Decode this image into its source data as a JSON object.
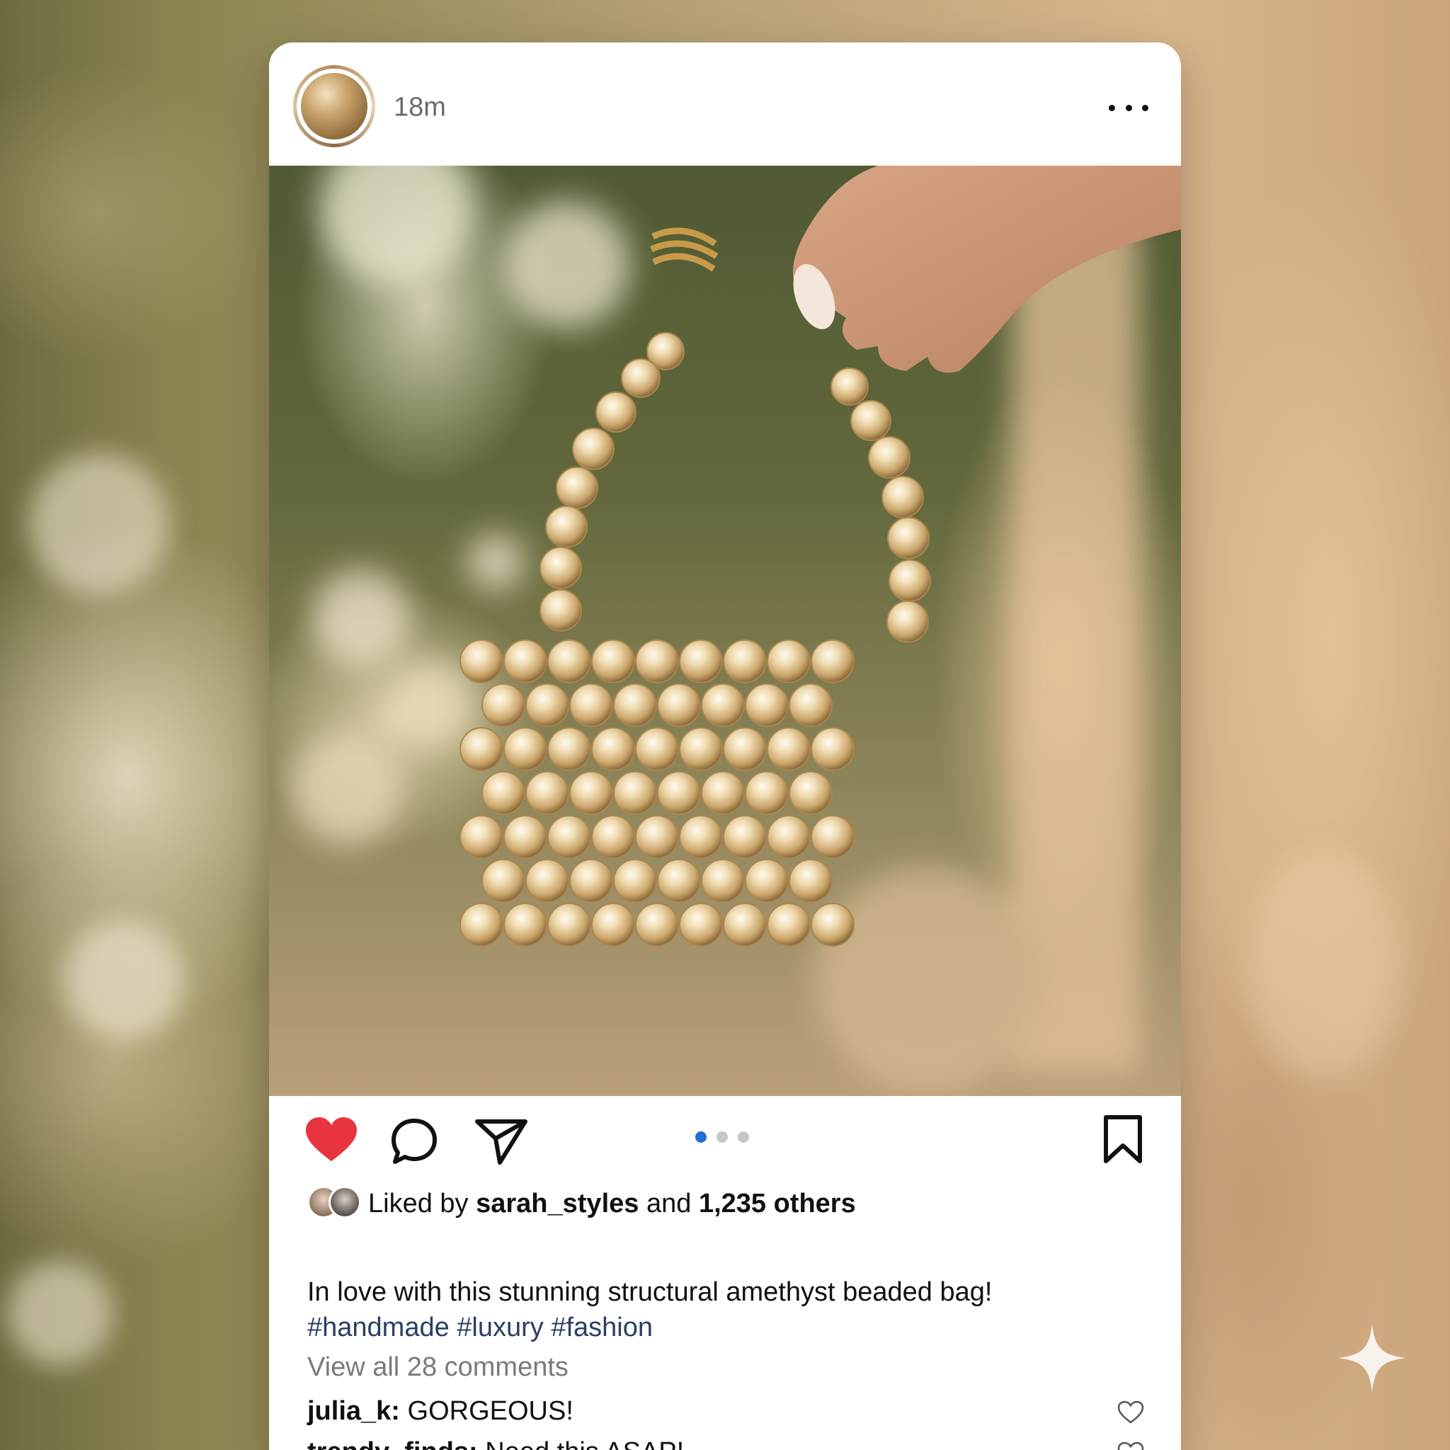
{
  "post": {
    "time_ago": "18m",
    "more_icon": "more-horizontal-icon"
  },
  "carousel": {
    "total": 3,
    "active_index": 0
  },
  "actions": {
    "like_icon": "heart-filled-icon",
    "comment_icon": "comment-icon",
    "share_icon": "send-icon",
    "save_icon": "bookmark-icon",
    "liked": true
  },
  "likes": {
    "prefix": "Liked by",
    "user": "sarah_styles",
    "connector": "and",
    "others": "1,235 others"
  },
  "caption": {
    "text": "In love with this stunning structural amethyst beaded bag!",
    "hashtags": "#handmade #luxury #fashion"
  },
  "view_comments": "View all 28 comments",
  "comments": [
    {
      "user": "julia_k:",
      "text": "GORGEOUS!"
    },
    {
      "user": "trendy_finds:",
      "text": "Need this ASAP!"
    }
  ],
  "colors": {
    "like_red": "#e8343f",
    "carousel_active": "#1f6fd1",
    "hashtag": "#2a3f64"
  }
}
